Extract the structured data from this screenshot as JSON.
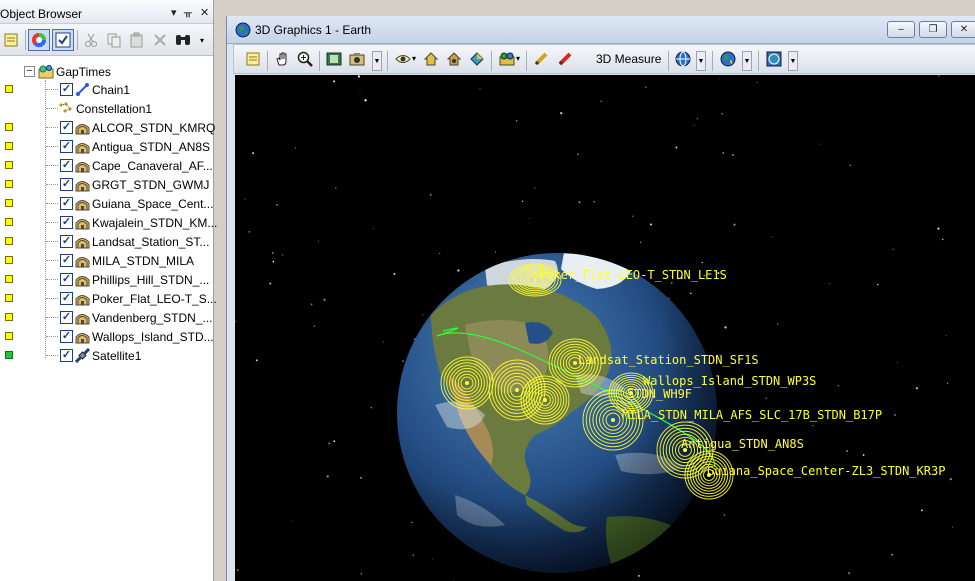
{
  "object_browser": {
    "title": "Object Browser",
    "pin_glyph": "▾ ⊓ ✕",
    "root": "GapTimes",
    "items": [
      {
        "label": "Chain1",
        "status": "yellow",
        "checked": true,
        "icon": "chain-icon"
      },
      {
        "label": "Constellation1",
        "status": "",
        "checked": false,
        "icon": "constellation-icon"
      },
      {
        "label": "ALCOR_STDN_KMRQ",
        "status": "yellow",
        "checked": true,
        "icon": "facility-icon"
      },
      {
        "label": "Antigua_STDN_AN8S",
        "status": "yellow",
        "checked": true,
        "icon": "facility-icon"
      },
      {
        "label": "Cape_Canaveral_AF...",
        "status": "yellow",
        "checked": true,
        "icon": "facility-icon"
      },
      {
        "label": "GRGT_STDN_GWMJ",
        "status": "yellow",
        "checked": true,
        "icon": "facility-icon"
      },
      {
        "label": "Guiana_Space_Cent...",
        "status": "yellow",
        "checked": true,
        "icon": "facility-icon"
      },
      {
        "label": "Kwajalein_STDN_KM...",
        "status": "yellow",
        "checked": true,
        "icon": "facility-icon"
      },
      {
        "label": "Landsat_Station_ST...",
        "status": "yellow",
        "checked": true,
        "icon": "facility-icon"
      },
      {
        "label": "MILA_STDN_MILA",
        "status": "yellow",
        "checked": true,
        "icon": "facility-icon"
      },
      {
        "label": "Phillips_Hill_STDN_...",
        "status": "yellow",
        "checked": true,
        "icon": "facility-icon"
      },
      {
        "label": "Poker_Flat_LEO-T_S...",
        "status": "yellow",
        "checked": true,
        "icon": "facility-icon"
      },
      {
        "label": "Vandenberg_STDN_...",
        "status": "yellow",
        "checked": true,
        "icon": "facility-icon"
      },
      {
        "label": "Wallops_Island_STD...",
        "status": "yellow",
        "checked": true,
        "icon": "facility-icon"
      },
      {
        "label": "Satellite1",
        "status": "green",
        "checked": true,
        "icon": "satellite-icon"
      }
    ]
  },
  "graphics_window": {
    "title": "3D Graphics 1 - Earth",
    "measure_label": "3D Measure",
    "window_buttons": [
      "–",
      "❐",
      "✕"
    ]
  },
  "scene_labels": [
    "Poker_Flat_LEO-T_STDN_LE1S",
    "Landsat_Station_STDN_SF1S",
    "Wallops_Island_STDN_WP3S",
    "STDN_WH9F",
    "MILA_STDN_MILA_AFS_SLC_17B_STDN_B17P",
    "Antigua_STDN_AN8S",
    "Guiana_Space_Center-ZL3_STDN_KR3P"
  ],
  "colors": {
    "label_yellow": "#ffff33",
    "orbit_green": "#2aff3a",
    "space": "#000000"
  }
}
